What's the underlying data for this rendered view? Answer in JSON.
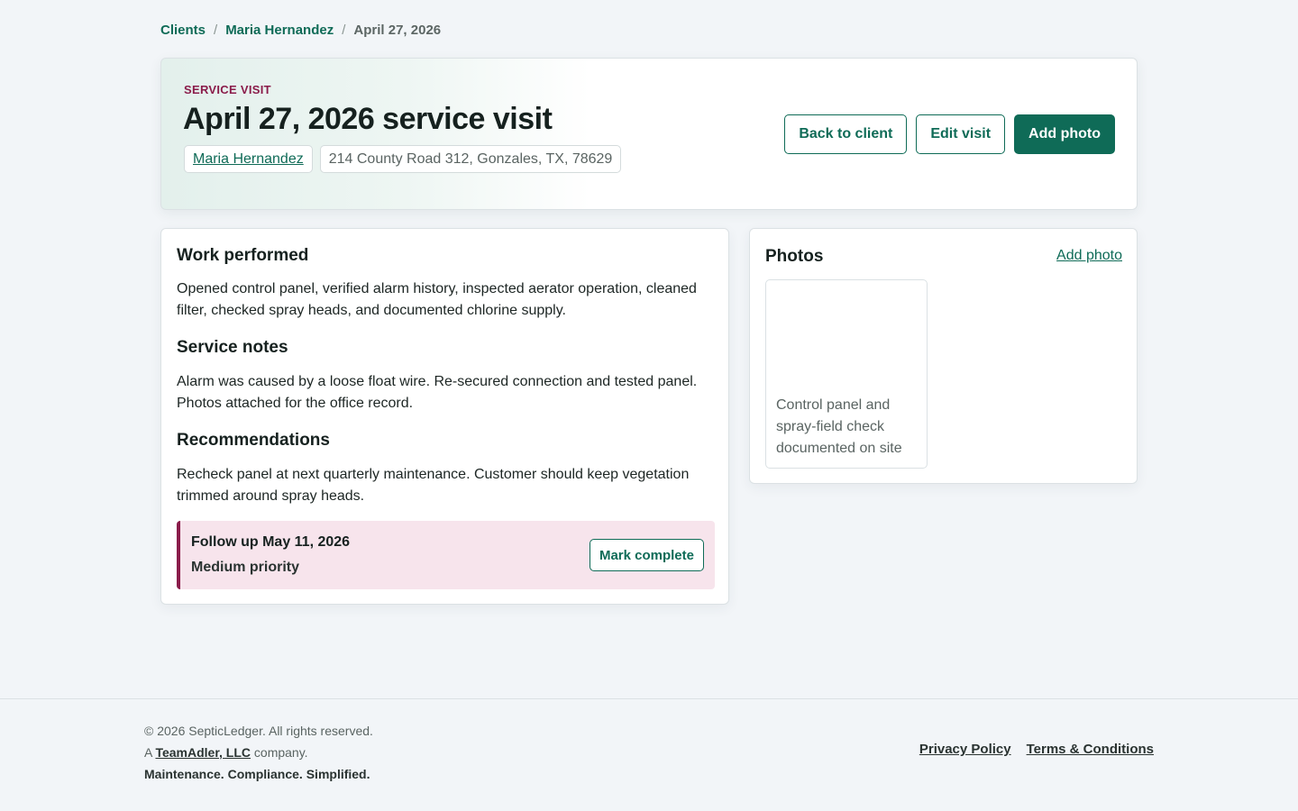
{
  "breadcrumb": {
    "items": [
      "Clients",
      "Maria Hernandez"
    ],
    "separator": "/",
    "current": "April 27, 2026"
  },
  "hero": {
    "eyebrow": "SERVICE VISIT",
    "title": "April 27, 2026 service visit",
    "client_name": "Maria Hernandez",
    "address": "214 County Road 312, Gonzales, TX, 78629",
    "buttons": {
      "back": "Back to client",
      "edit": "Edit visit",
      "add_photo": "Add photo"
    }
  },
  "visit": {
    "work_heading": "Work performed",
    "work_text": "Opened control panel, verified alarm history, inspected aerator operation, cleaned filter, checked spray heads, and documented chlorine supply.",
    "notes_heading": "Service notes",
    "notes_text": "Alarm was caused by a loose float wire. Re-secured connection and tested panel. Photos attached for the office record.",
    "recs_heading": "Recommendations",
    "recs_text": "Recheck panel at next quarterly maintenance. Customer should keep vegetation trimmed around spray heads.",
    "followup": {
      "title": "Follow up May 11, 2026",
      "priority": "Medium priority",
      "button": "Mark complete"
    }
  },
  "photos": {
    "heading": "Photos",
    "add_link": "Add photo",
    "items": [
      {
        "caption": "Control panel and spray-field check documented on site"
      }
    ]
  },
  "footer": {
    "copyright": "© 2026 SepticLedger. All rights reserved.",
    "company_prefix": "A",
    "company_name": "TeamAdler, LLC",
    "company_suffix": "company.",
    "tagline": "Maintenance. Compliance. Simplified.",
    "links": [
      "Privacy Policy",
      "Terms & Conditions"
    ]
  },
  "colors": {
    "brand": "#0f6b57",
    "accent": "#8a1c4a",
    "background": "#f2f5f8"
  }
}
